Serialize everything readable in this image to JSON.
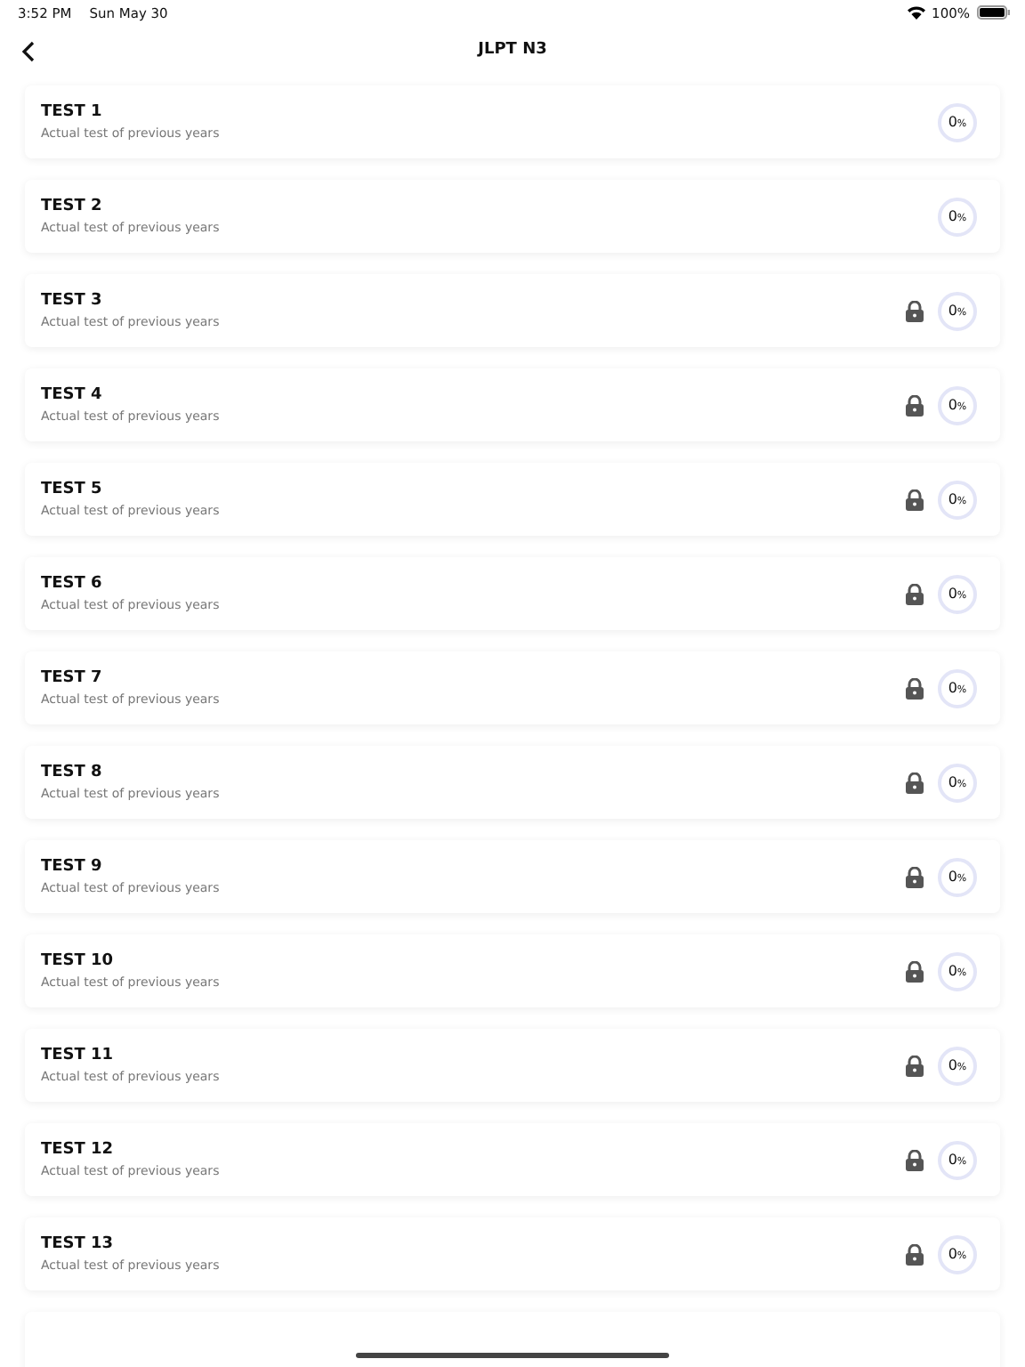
{
  "status_bar": {
    "time": "3:52 PM",
    "date": "Sun May 30",
    "battery": "100%"
  },
  "header": {
    "title": "JLPT N3"
  },
  "tests": [
    {
      "title": "TEST 1",
      "subtitle": "Actual test of previous years",
      "locked": false,
      "level": 0,
      "value": "0",
      "unit": "%"
    },
    {
      "title": "TEST 2",
      "subtitle": "Actual test of previous years",
      "locked": false,
      "level": 0,
      "value": "0",
      "unit": "%"
    },
    {
      "title": "TEST 3",
      "subtitle": "Actual test of previous years",
      "locked": true,
      "level": 0,
      "value": "0",
      "unit": "%"
    },
    {
      "title": "TEST 4",
      "subtitle": "Actual test of previous years",
      "locked": true,
      "level": 0,
      "value": "0",
      "unit": "%"
    },
    {
      "title": "TEST 5",
      "subtitle": "Actual test of previous years",
      "locked": true,
      "level": 0,
      "value": "0",
      "unit": "%"
    },
    {
      "title": "TEST 6",
      "subtitle": "Actual test of previous years",
      "locked": true,
      "level": 0,
      "value": "0",
      "unit": "%"
    },
    {
      "title": "TEST 7",
      "subtitle": "Actual test of previous years",
      "locked": true,
      "level": 0,
      "value": "0",
      "unit": "%"
    },
    {
      "title": "TEST 8",
      "subtitle": "Actual test of previous years",
      "locked": true,
      "level": 0,
      "value": "0",
      "unit": "%"
    },
    {
      "title": "TEST 9",
      "subtitle": "Actual test of previous years",
      "locked": true,
      "level": 0,
      "value": "0",
      "unit": "%"
    },
    {
      "title": "TEST 10",
      "subtitle": "Actual test of previous years",
      "locked": true,
      "level": 0,
      "value": "0",
      "unit": "%"
    },
    {
      "title": "TEST 11",
      "subtitle": "Actual test of previous years",
      "locked": true,
      "level": 0,
      "value": "0",
      "unit": "%"
    },
    {
      "title": "TEST 12",
      "subtitle": "Actual test of previous years",
      "locked": true,
      "level": 0,
      "value": "0",
      "unit": "%"
    },
    {
      "title": "TEST 13",
      "subtitle": "Actual test of previous years",
      "locked": true,
      "level": 0,
      "value": "0",
      "unit": "%"
    }
  ]
}
